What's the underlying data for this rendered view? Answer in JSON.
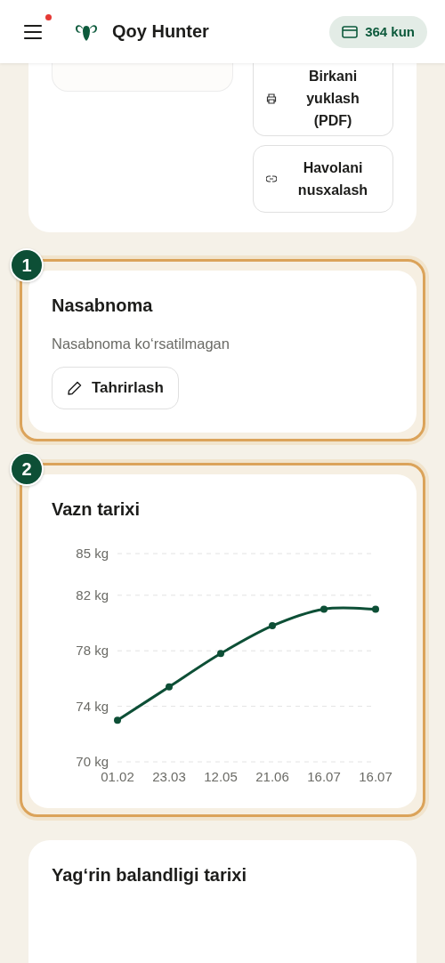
{
  "header": {
    "title": "Qoy Hunter",
    "menu_notification": true,
    "days_badge": "364 kun"
  },
  "top_card": {
    "buttons": [
      {
        "kind": "print",
        "label": "Birkani yuklash (PDF)"
      },
      {
        "kind": "link",
        "label": "Havolani nusxalash"
      }
    ]
  },
  "pedigree": {
    "step": "1",
    "highlighted": true,
    "title": "Nasabnoma",
    "text": "Nasabnoma ko‘rsatilmagan",
    "edit_button": "Tahrirlash"
  },
  "weight": {
    "step": "2",
    "highlighted": true,
    "title": "Vazn tarixi",
    "chart_data": {
      "type": "line",
      "categories": [
        "01.02",
        "23.03",
        "12.05",
        "21.06",
        "16.07",
        "16.07"
      ],
      "grid": true,
      "series": [
        {
          "color": "#0d4f36",
          "marker": true,
          "values": [
            73.0,
            75.4,
            77.8,
            79.8,
            81.0,
            81.0
          ]
        }
      ],
      "ylim": [
        70,
        85
      ],
      "yticks": [
        {
          "value": 70,
          "label": "70 kg"
        },
        {
          "value": 74,
          "label": "74 kg"
        },
        {
          "value": 78,
          "label": "78 kg"
        },
        {
          "value": 82,
          "label": "82 kg"
        },
        {
          "value": 85,
          "label": "85 kg"
        }
      ]
    }
  },
  "shoulder": {
    "title": "Yag‘rin balandligi tarixi"
  }
}
